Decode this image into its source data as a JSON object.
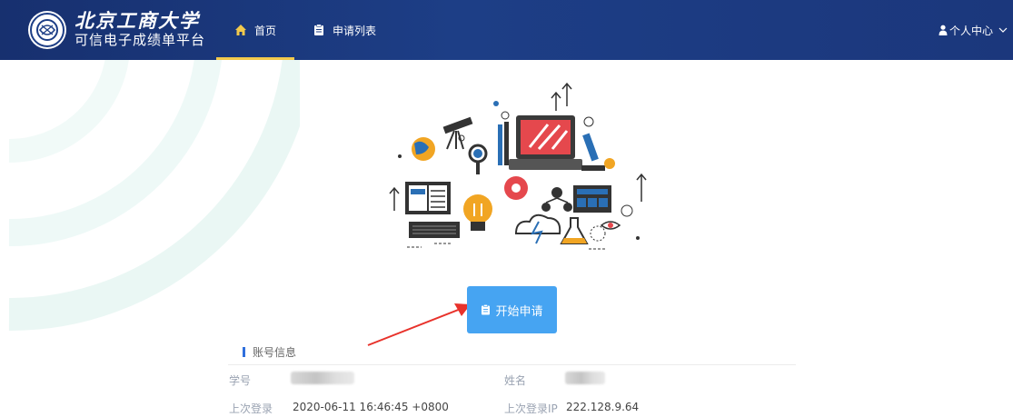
{
  "header": {
    "title": "北京工商大学",
    "subtitle": "可信电子成绩单平台",
    "nav": [
      {
        "label": "首页",
        "icon": "home-icon",
        "active": true
      },
      {
        "label": "申请列表",
        "icon": "clipboard-icon",
        "active": false
      }
    ],
    "user_menu": {
      "label": "个人中心",
      "icon": "user-icon",
      "chevron": "chevron-down-icon"
    }
  },
  "main": {
    "start_button": {
      "label": "开始申请",
      "icon": "clipboard-icon"
    }
  },
  "account": {
    "title": "账号信息",
    "fields": {
      "student_id": {
        "label": "学号",
        "value": ""
      },
      "name": {
        "label": "姓名",
        "value": ""
      },
      "last_login": {
        "label": "上次登录",
        "value": "2020-06-11 16:46:45 +0800"
      },
      "last_login_ip": {
        "label": "上次登录IP",
        "value": "222.128.9.64"
      }
    }
  },
  "colors": {
    "header_bg": "#1d3e86",
    "active_underline": "#f2c94c",
    "primary_button": "#46a4f2",
    "annotation_arrow": "#e8322b",
    "deco_arc": "#e9f7f5"
  }
}
